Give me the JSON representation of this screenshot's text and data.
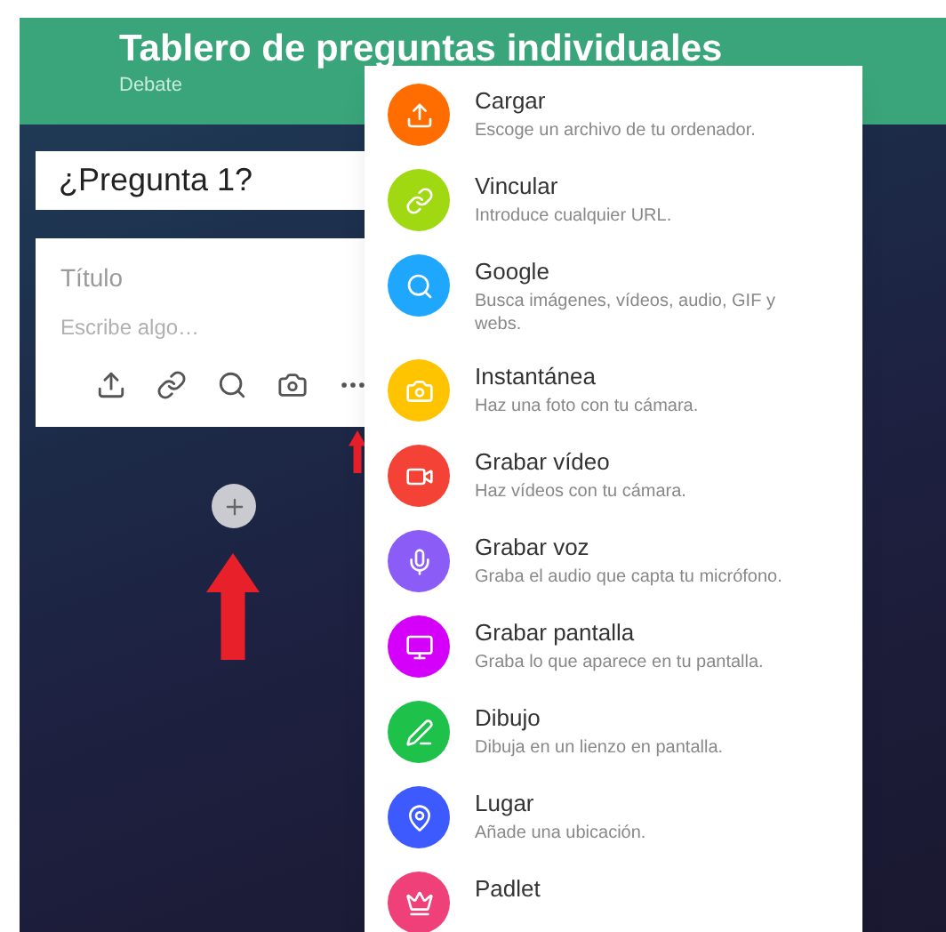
{
  "header": {
    "title": "Tablero de preguntas individuales",
    "subtitle": "Debate"
  },
  "question_field": {
    "value": "¿Pregunta 1?"
  },
  "post_card": {
    "title_placeholder": "Título",
    "body_placeholder": "Escribe algo…"
  },
  "menu": {
    "items": [
      {
        "title": "Cargar",
        "description": "Escoge un archivo de tu ordenador.",
        "color": "#ff6d00"
      },
      {
        "title": "Vincular",
        "description": "Introduce cualquier URL.",
        "color": "#a0d911"
      },
      {
        "title": "Google",
        "description": "Busca imágenes, vídeos, audio, GIF y webs.",
        "color": "#1ea7fd"
      },
      {
        "title": "Instantánea",
        "description": "Haz una foto con tu cámara.",
        "color": "#ffc400"
      },
      {
        "title": "Grabar vídeo",
        "description": "Haz vídeos con tu cámara.",
        "color": "#f44336"
      },
      {
        "title": "Grabar voz",
        "description": "Graba el audio que capta tu micrófono.",
        "color": "#8b5cf6"
      },
      {
        "title": "Grabar pantalla",
        "description": "Graba lo que aparece en tu pantalla.",
        "color": "#d500f9"
      },
      {
        "title": "Dibujo",
        "description": "Dibuja en un lienzo en pantalla.",
        "color": "#1ec24a"
      },
      {
        "title": "Lugar",
        "description": "Añade una ubicación.",
        "color": "#3d5afe"
      },
      {
        "title": "Padlet",
        "color": "#f0407a"
      }
    ]
  }
}
